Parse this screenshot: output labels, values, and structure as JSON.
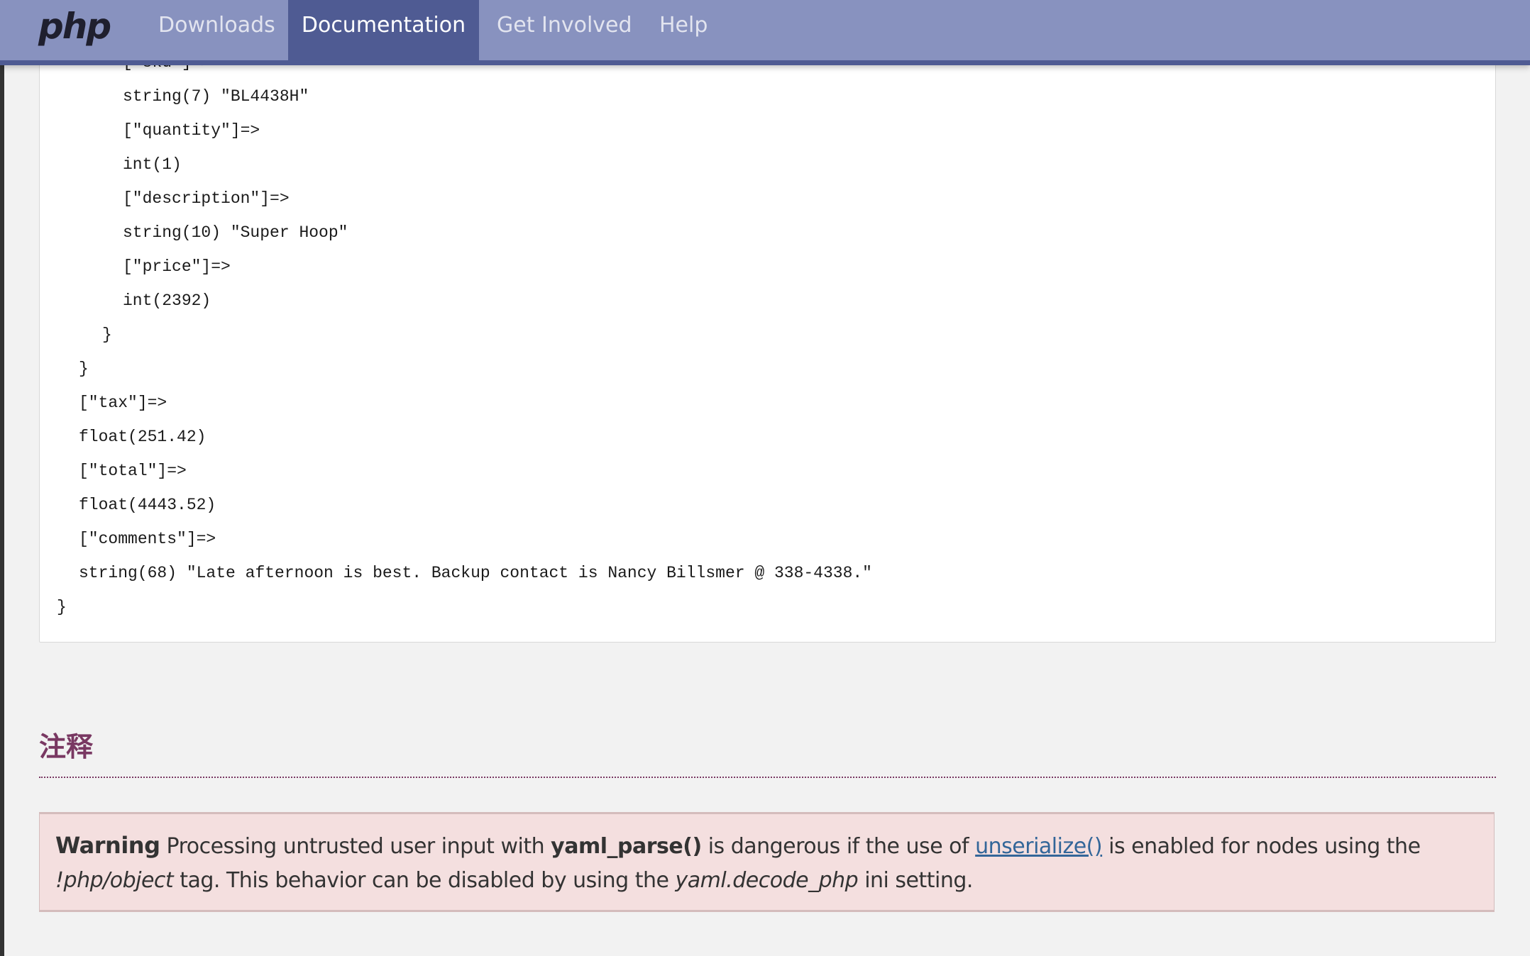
{
  "nav": {
    "logo": "php",
    "items": [
      {
        "label": "Downloads",
        "active": false
      },
      {
        "label": "Documentation",
        "active": true
      },
      {
        "label": "Get Involved",
        "active": false
      },
      {
        "label": "Help",
        "active": false
      }
    ]
  },
  "code_lines": [
    {
      "indent": 3,
      "text": "[\"sku\"]=>"
    },
    {
      "indent": 3,
      "text": "string(7) \"BL4438H\""
    },
    {
      "indent": 3,
      "text": "[\"quantity\"]=>"
    },
    {
      "indent": 3,
      "text": "int(1)"
    },
    {
      "indent": 3,
      "text": "[\"description\"]=>"
    },
    {
      "indent": 3,
      "text": "string(10) \"Super Hoop\""
    },
    {
      "indent": 3,
      "text": "[\"price\"]=>"
    },
    {
      "indent": 3,
      "text": "int(2392)"
    },
    {
      "indent": 2,
      "text": "}"
    },
    {
      "indent": 1,
      "text": "}"
    },
    {
      "indent": 1,
      "text": "[\"tax\"]=>"
    },
    {
      "indent": 1,
      "text": "float(251.42)"
    },
    {
      "indent": 1,
      "text": "[\"total\"]=>"
    },
    {
      "indent": 1,
      "text": "float(4443.52)"
    },
    {
      "indent": 1,
      "text": "[\"comments\"]=>"
    },
    {
      "indent": 1,
      "text": "string(68) \"Late afternoon is best. Backup contact is Nancy Billsmer @ 338-4338.\""
    },
    {
      "indent": 0,
      "text": "}"
    }
  ],
  "notes": {
    "heading": "注释",
    "warning": {
      "label": "Warning",
      "t1": " Processing untrusted user input with ",
      "func": "yaml_parse()",
      "t2": " is dangerous if the use of ",
      "link": "unserialize()",
      "t3": " is enabled for nodes using the ",
      "tag": "!php/object",
      "t4": " tag. This behavior can be disabled by using the ",
      "setting": "yaml.decode_php",
      "t5": " ini setting."
    }
  },
  "colors": {
    "nav": "#8892bf",
    "nav_active": "#4f5b93",
    "heading": "#793862",
    "warning_bg": "#f4dfdf",
    "link": "#336699"
  }
}
